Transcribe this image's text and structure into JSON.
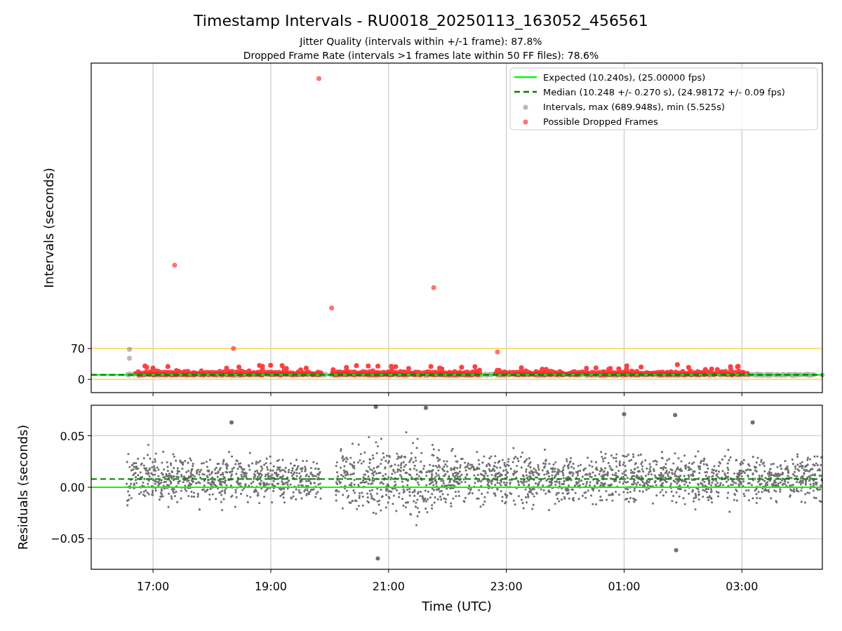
{
  "figure": {
    "title": "Timestamp Intervals - RU0018_20250113_163052_456561",
    "subtitles": [
      "Jitter Quality (intervals within +/-1 frame): 87.8%",
      "Dropped Frame Rate (intervals >1 frames late within 50 FF files): 78.6%"
    ]
  },
  "intervals_panel": {
    "chart_data": {
      "type": "scatter",
      "ylabel": "Intervals (seconds)",
      "xlim": [
        "2025-01-13T15:57",
        "2025-01-14T04:22"
      ],
      "ylim": [
        -30,
        717
      ],
      "yticks": [
        0,
        70
      ],
      "grid": true,
      "legend": true,
      "ref_lines": [
        {
          "axis": "y",
          "value": 70,
          "color": "#ffd24d"
        },
        {
          "axis": "y",
          "value": 0,
          "color": "#ffd24d"
        }
      ],
      "series": [
        {
          "name": "Expected (10.240s), (25.00000 fps)",
          "color": "#00ff00",
          "type": "line",
          "x": [
            "2025-01-13T15:57",
            "2025-01-14T04:22"
          ],
          "values": [
            10.24,
            10.24
          ]
        },
        {
          "name": "Median (10.248 +/- 0.270 s), (24.98172 +/- 0.09 fps)",
          "color": "#007f00",
          "type": "line",
          "line_style": "dashed",
          "x": [
            "2025-01-13T15:57",
            "2025-01-14T04:22"
          ],
          "values": [
            10.248,
            10.248
          ]
        },
        {
          "name": "Intervals, max (689.948s), min (5.525s)",
          "color": "#808080",
          "type": "scatter",
          "x": [
            "2025-01-13T16:36",
            "2025-01-13T16:36"
          ],
          "values": [
            68,
            48
          ]
        },
        {
          "name": "Possible Dropped Frames",
          "color": "#ff0000",
          "type": "scatter",
          "x": [
            "2025-01-13T19:49",
            "2025-01-13T17:22",
            "2025-01-13T21:46",
            "2025-01-13T20:02",
            "2025-01-13T18:22",
            "2025-01-13T22:51"
          ],
          "values": [
            682,
            259,
            208,
            162,
            70,
            62
          ]
        }
      ]
    }
  },
  "residuals_panel": {
    "chart_data": {
      "type": "scatter",
      "xlabel": "Time (UTC)",
      "ylabel": "Residuals (seconds)",
      "xlim": [
        "2025-01-13T15:57",
        "2025-01-14T04:22"
      ],
      "ylim": [
        -0.0796,
        0.0796
      ],
      "grid": true,
      "xticks": [
        {
          "value": "2025-01-13T17:00",
          "label": "17:00"
        },
        {
          "value": "2025-01-13T19:00",
          "label": "19:00"
        },
        {
          "value": "2025-01-13T21:00",
          "label": "21:00"
        },
        {
          "value": "2025-01-13T23:00",
          "label": "23:00"
        },
        {
          "value": "2025-01-14T01:00",
          "label": "01:00"
        },
        {
          "value": "2025-01-14T03:00",
          "label": "03:00"
        }
      ],
      "yticks": [
        {
          "value": -0.05,
          "label": "−0.05"
        },
        {
          "value": 0,
          "label": "0.00"
        },
        {
          "value": 0.05,
          "label": "0.05"
        }
      ],
      "series": [
        {
          "color": "#00ff00",
          "type": "line",
          "x": [
            "2025-01-13T15:57",
            "2025-01-14T04:22"
          ],
          "values": [
            0,
            0
          ]
        },
        {
          "color": "#007f00",
          "type": "line",
          "line_style": "dashed",
          "x": [
            "2025-01-13T15:57",
            "2025-01-14T04:22"
          ],
          "values": [
            0.008,
            0.008
          ]
        },
        {
          "color": "#707070",
          "type": "scatter",
          "x": [
            "2025-01-13T18:20",
            "2025-01-13T20:47",
            "2025-01-13T21:38",
            "2025-01-14T01:00",
            "2025-01-14T01:52",
            "2025-01-14T03:11",
            "2025-01-13T20:49",
            "2025-01-14T01:53"
          ],
          "values": [
            0.063,
            0.078,
            0.077,
            0.071,
            0.07,
            0.063,
            -0.069,
            -0.061
          ]
        }
      ]
    }
  }
}
